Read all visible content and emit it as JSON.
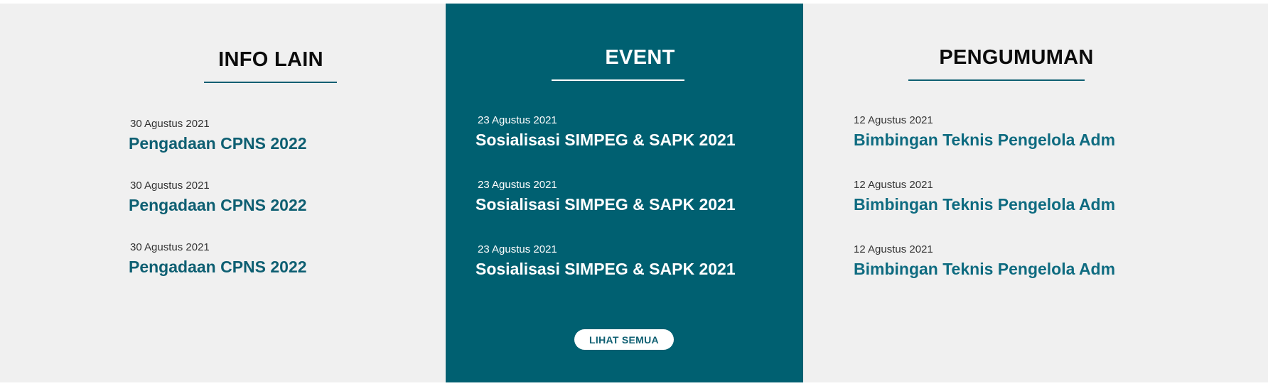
{
  "info_lain": {
    "heading": "INFO LAIN",
    "items": [
      {
        "date": "30 Agustus 2021",
        "title": "Pengadaan CPNS 2022"
      },
      {
        "date": "30 Agustus 2021",
        "title": "Pengadaan CPNS 2022"
      },
      {
        "date": "30 Agustus 2021",
        "title": "Pengadaan CPNS 2022"
      }
    ]
  },
  "event": {
    "heading": "EVENT",
    "items": [
      {
        "date": "23 Agustus 2021",
        "title": "Sosialisasi SIMPEG & SAPK 2021"
      },
      {
        "date": "23 Agustus 2021",
        "title": "Sosialisasi SIMPEG & SAPK 2021"
      },
      {
        "date": "23 Agustus 2021",
        "title": "Sosialisasi SIMPEG & SAPK 2021"
      }
    ],
    "button_label": "LIHAT SEMUA"
  },
  "pengumuman": {
    "heading": "PENGUMUMAN",
    "items": [
      {
        "date": "12 Agustus 2021",
        "title": "Bimbingan Teknis Pengelola Adm"
      },
      {
        "date": "12 Agustus 2021",
        "title": "Bimbingan Teknis Pengelola Adm"
      },
      {
        "date": "12 Agustus 2021",
        "title": "Bimbingan Teknis Pengelola Adm"
      }
    ]
  },
  "colors": {
    "accent_teal": "#006071",
    "link_teal": "#0e5f72",
    "panel_gray": "#f0f0f0"
  }
}
